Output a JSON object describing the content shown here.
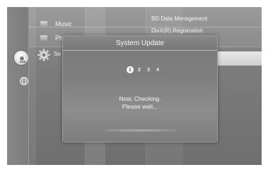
{
  "menu": {
    "items": [
      {
        "label": "Music",
        "icon": "music-icon"
      },
      {
        "label": "Ph",
        "icon": "photo-icon"
      },
      {
        "label": "Se",
        "icon": "gear-icon"
      }
    ]
  },
  "top_menu": {
    "items": [
      {
        "label": "BD Data Menagement"
      },
      {
        "label": "DivX(R) Registration"
      }
    ]
  },
  "left_icons": [
    {
      "name": "disc-icon",
      "text": "DVD"
    },
    {
      "name": "globe-icon"
    }
  ],
  "dialog": {
    "title": "System Update",
    "steps": [
      "1",
      "2",
      "3",
      "4"
    ],
    "active_step": "1",
    "message_line1": "Now, Checking.",
    "message_line2": "Please wait..."
  }
}
